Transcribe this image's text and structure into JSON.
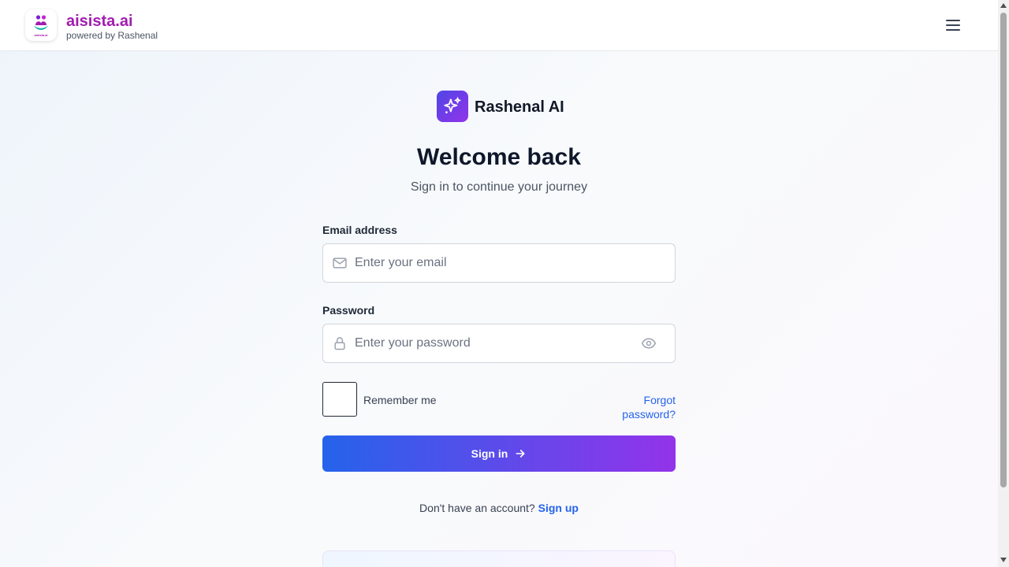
{
  "header": {
    "brand_name": "aisista.ai",
    "brand_sub": "powered by Rashenal",
    "logo_text": "aisista.ai",
    "logo_icon": "people-in-hand-icon",
    "menu_icon": "hamburger-menu-icon"
  },
  "hero": {
    "app_name": "Rashenal AI",
    "app_icon": "sparkles-icon",
    "title": "Welcome back",
    "subtitle": "Sign in to continue your journey"
  },
  "form": {
    "email_label": "Email address",
    "email_placeholder": "Enter your email",
    "email_value": "",
    "email_icon": "mail-icon",
    "password_label": "Password",
    "password_placeholder": "Enter your password",
    "password_value": "",
    "password_icon": "lock-icon",
    "show_password_icon": "eye-icon",
    "remember_label": "Remember me",
    "remember_checked": false,
    "forgot_label": "Forgot password?",
    "signin_label": "Sign in",
    "signin_icon": "arrow-right-icon"
  },
  "signup": {
    "prompt": "Don't have an account?",
    "link": "Sign up"
  },
  "colors": {
    "brand": "#a21caf",
    "link": "#2563eb",
    "gradient_start": "#2563eb",
    "gradient_end": "#9333ea",
    "badge_start": "#4f46e5",
    "badge_end": "#9333ea"
  }
}
